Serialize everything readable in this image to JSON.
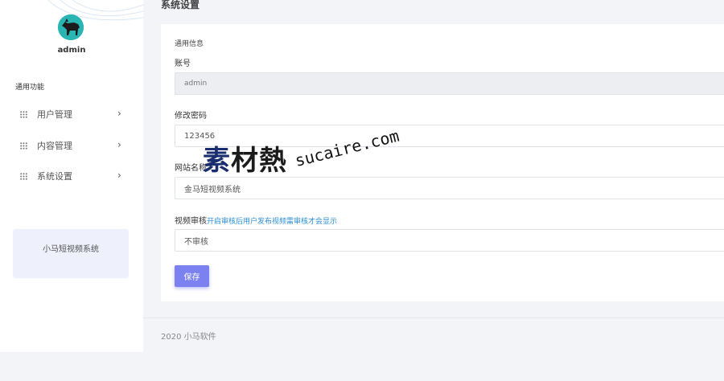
{
  "sidebar": {
    "username": "admin",
    "section_title": "通用功能",
    "items": [
      {
        "label": "用户管理",
        "icon": "grid-icon",
        "chevron": "›"
      },
      {
        "label": "内容管理",
        "icon": "grid-icon",
        "chevron": "›"
      },
      {
        "label": "系统设置",
        "icon": "grid-icon",
        "chevron": "›"
      }
    ],
    "promo_text": "小马短视频系统"
  },
  "main": {
    "page_title": "系统设置",
    "group_title": "通用信息",
    "fields": {
      "account": {
        "label": "账号",
        "value": "admin"
      },
      "password": {
        "label": "修改密码",
        "value": "123456"
      },
      "site_name": {
        "label": "网站名称",
        "value": "金马短视频系统"
      },
      "video_review": {
        "label": "视频审核",
        "hint": "开启审核后用户发布视频需审核才会显示",
        "value": "不审核"
      }
    },
    "save_label": "保存"
  },
  "footer": {
    "text": "2020 小马软件"
  },
  "watermark": {
    "cn_part1": "素",
    "cn_part2": "材熱",
    "en": "sucaire.com"
  },
  "colors": {
    "accent": "#7b82f0",
    "hint": "#2c8fd6",
    "background": "#f3f4f8"
  }
}
